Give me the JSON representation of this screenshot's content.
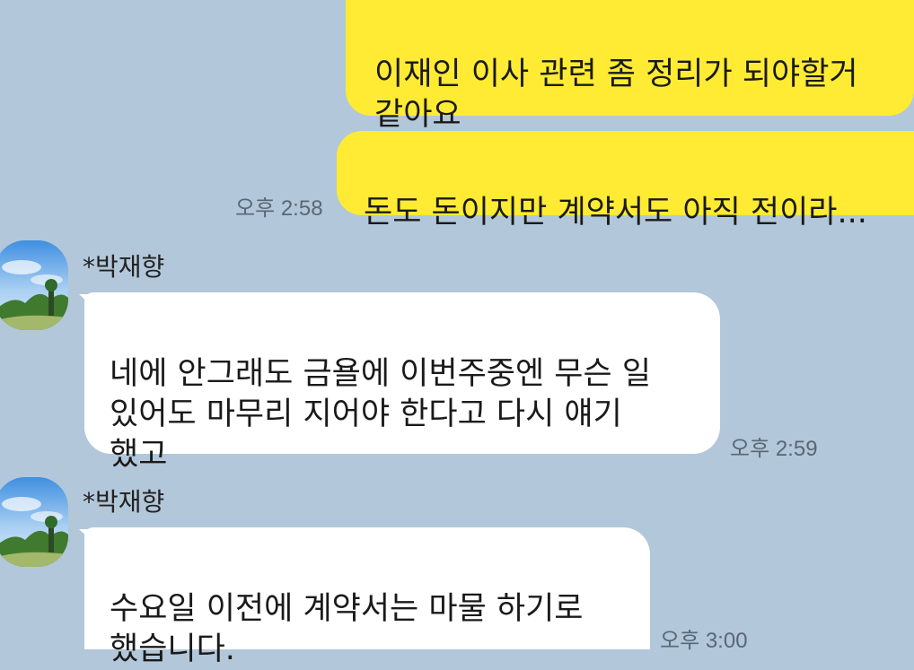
{
  "outgoing": [
    {
      "text": "이재인 이사 관련 좀 정리가 되야할거\n같아요"
    },
    {
      "text": "돈도 돈이지만 계약서도 아직 전이라..."
    }
  ],
  "outgoing_time": "오후 2:58",
  "incoming": [
    {
      "sender": "*박재향",
      "text": "네에 안그래도 금욜에 이번주중엔 무슨 일\n있어도 마무리 지어야 한다고 다시 얘기\n했고",
      "time": "오후 2:59"
    },
    {
      "sender": "*박재향",
      "text": "수요일 이전에 계약서는 마물 하기로\n했습니다.",
      "time": "오후 3:00"
    }
  ],
  "colors": {
    "background": "#b2c7da",
    "outgoing_bubble": "#ffeb33",
    "incoming_bubble": "#ffffff"
  }
}
